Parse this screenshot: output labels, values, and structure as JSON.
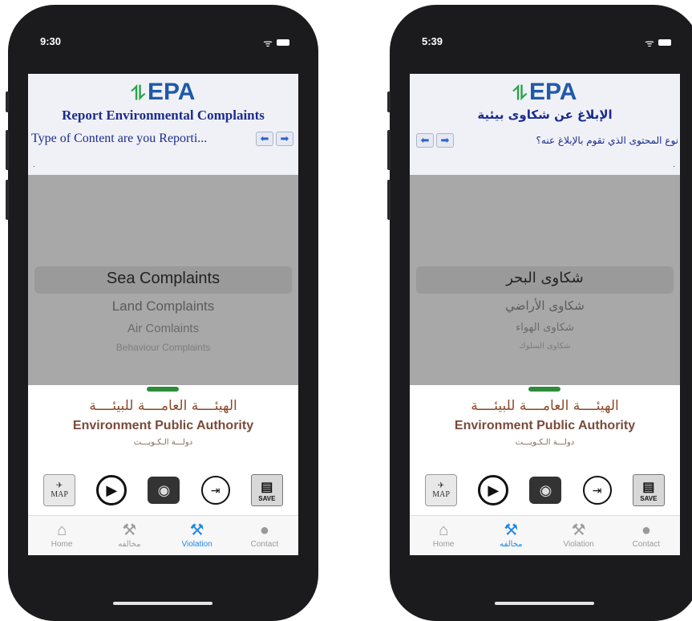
{
  "left_phone": {
    "status": {
      "time": "9:30",
      "icons": "📶 ▮"
    },
    "logo": "EPA",
    "title": "Report Environmental Complaints",
    "prompt": "Type of Content are you Reporti...",
    "dot": ".",
    "picker": [
      "Sea Complaints",
      "Land Complaints",
      "Air Comlaints",
      "Behaviour Complaints"
    ],
    "authority": {
      "ar": "الهيئــــة العامــــة للبيئــــة",
      "en": "Environment Public Authority",
      "kw": "دولـــة الـكـويـــت"
    },
    "tools": {
      "map": "MAP",
      "save": "SAVE"
    },
    "tabs": [
      "Home",
      "مخالفه",
      "Violation",
      "Contact"
    ],
    "active_tab": 2
  },
  "right_phone": {
    "status": {
      "time": "5:39",
      "icons": "📶 ▮"
    },
    "logo": "EPA",
    "title": "الإبلاغ عن شكاوى بيئية",
    "prompt": "نوع المحتوى الذي تقوم بالإبلاغ عنه؟",
    "dot": ".",
    "picker": [
      "شكاوى البحر",
      "شكاوى الأراضي",
      "شكاوى الهواء",
      "شكاوى السلوك"
    ],
    "authority": {
      "ar": "الهيئــــة العامــــة للبيئــــة",
      "en": "Environment Public Authority",
      "kw": "دولـــة الـكـويـــت"
    },
    "tools": {
      "map": "MAP",
      "save": "SAVE"
    },
    "tabs": [
      "Home",
      "مخالفه",
      "Violation",
      "Contact"
    ],
    "active_tab": 1
  },
  "colors": {
    "accent": "#1e88e5",
    "title": "#1b2b8c",
    "picker_bg": "#a8a8a8"
  },
  "icons": [
    "epa-logo-icon",
    "left-arrow-icon",
    "right-arrow-icon",
    "map-icon",
    "video-icon",
    "camera-icon",
    "contact-login-icon",
    "save-icon",
    "home-icon",
    "gavel-icon",
    "person-icon"
  ]
}
